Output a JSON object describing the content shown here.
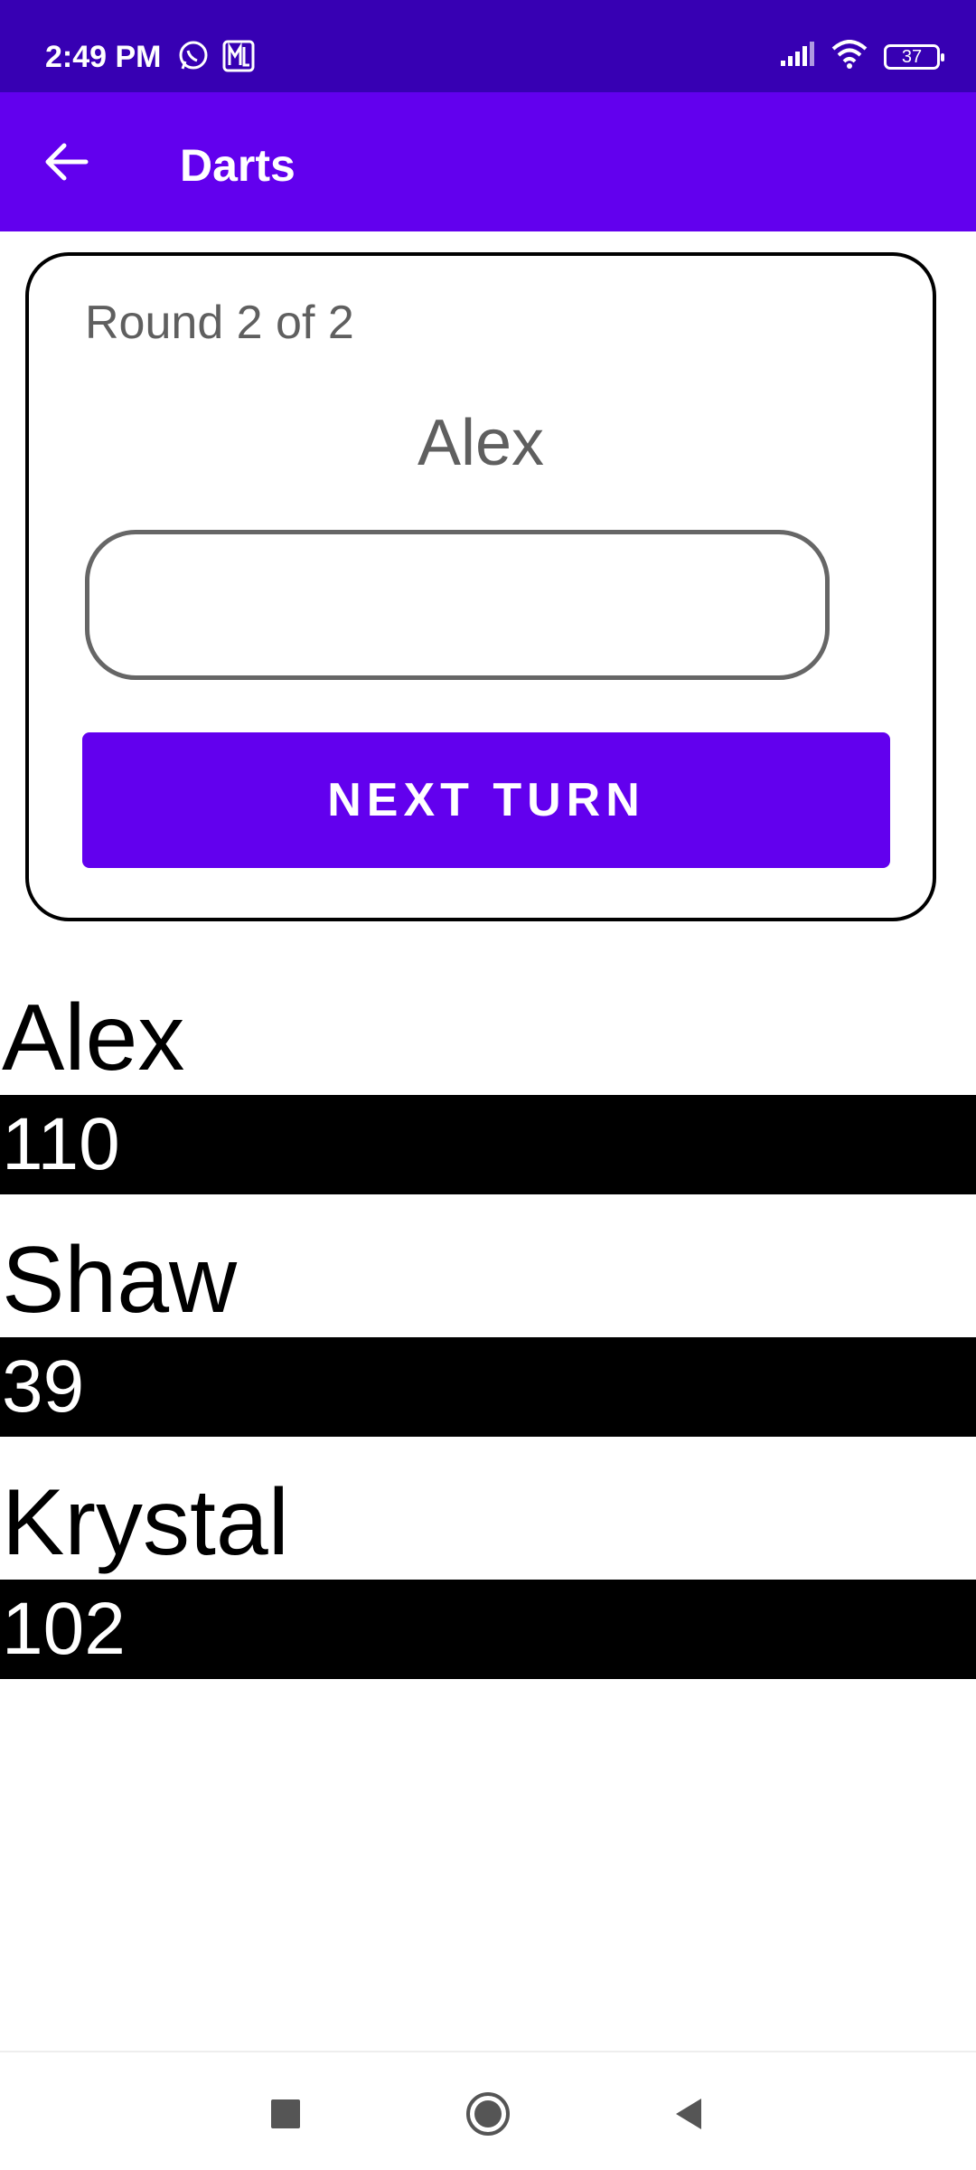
{
  "status_bar": {
    "time": "2:49 PM",
    "battery_level": "37",
    "icons": [
      "whatsapp-icon",
      "notification-icon",
      "signal-icon",
      "wifi-icon",
      "battery-icon"
    ]
  },
  "app_bar": {
    "title": "Darts",
    "back_icon": "arrow-back-icon"
  },
  "turn_card": {
    "round_label": "Round 2 of 2",
    "current_player": "Alex",
    "score_input_value": "",
    "next_button_label": "NEXT TURN"
  },
  "players": [
    {
      "name": "Alex",
      "score": "110"
    },
    {
      "name": "Shaw",
      "score": "39"
    },
    {
      "name": "Krystal",
      "score": "102"
    }
  ],
  "nav_bar": {
    "buttons": [
      "recents-square-icon",
      "home-circle-icon",
      "back-triangle-icon"
    ]
  },
  "colors": {
    "status_bar": "#3700b3",
    "app_bar": "#6200ee",
    "primary_button": "#6200ee",
    "score_row_bg": "#000000"
  }
}
